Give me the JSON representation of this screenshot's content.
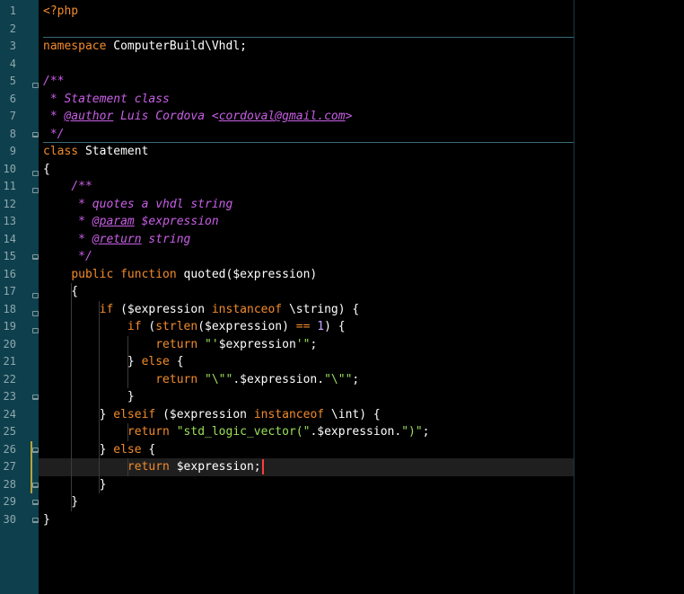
{
  "editor": {
    "language": "php",
    "current_line": 27,
    "colors": {
      "gutter": "#0e3f4c",
      "background": "#000000",
      "keyword": "#f28b2c",
      "comment": "#c95fe7",
      "string": "#9ae15a",
      "number": "#c9a5ff",
      "caret": "#ff3b3b"
    },
    "line_numbers": [
      "1",
      "2",
      "3",
      "4",
      "5",
      "6",
      "7",
      "8",
      "9",
      "10",
      "11",
      "12",
      "13",
      "14",
      "15",
      "16",
      "17",
      "18",
      "19",
      "20",
      "21",
      "22",
      "23",
      "24",
      "25",
      "26",
      "27",
      "28",
      "29",
      "30"
    ],
    "lines": [
      [
        {
          "t": "<?php",
          "c": "kw"
        }
      ],
      [],
      [
        {
          "t": "namespace",
          "c": "kw"
        },
        {
          "t": " ComputerBuild\\Vhdl;",
          "c": "ident"
        }
      ],
      [],
      [
        {
          "t": "/**",
          "c": "cm"
        }
      ],
      [
        {
          "t": " * Statement class",
          "c": "cm"
        }
      ],
      [
        {
          "t": " * ",
          "c": "cm"
        },
        {
          "t": "@author",
          "c": "cm-tag"
        },
        {
          "t": " Luis Cordova <",
          "c": "cm"
        },
        {
          "t": "cordoval@gmail.com",
          "c": "cm-tag"
        },
        {
          "t": ">",
          "c": "cm"
        }
      ],
      [
        {
          "t": " */",
          "c": "cm"
        }
      ],
      [
        {
          "t": "class",
          "c": "kw"
        },
        {
          "t": " Statement",
          "c": "ident"
        }
      ],
      [
        {
          "t": "{",
          "c": "ident"
        }
      ],
      [
        {
          "t": "    ",
          "c": "ident"
        },
        {
          "t": "/**",
          "c": "cm"
        }
      ],
      [
        {
          "t": "     * quotes a vhdl string",
          "c": "cm"
        }
      ],
      [
        {
          "t": "     * ",
          "c": "cm"
        },
        {
          "t": "@param",
          "c": "cm-tag"
        },
        {
          "t": " $expression",
          "c": "cm"
        }
      ],
      [
        {
          "t": "     * ",
          "c": "cm"
        },
        {
          "t": "@return",
          "c": "cm-tag"
        },
        {
          "t": " string",
          "c": "cm"
        }
      ],
      [
        {
          "t": "     */",
          "c": "cm"
        }
      ],
      [
        {
          "t": "    ",
          "c": "ident"
        },
        {
          "t": "public function",
          "c": "kw"
        },
        {
          "t": " quoted($expression)",
          "c": "ident"
        }
      ],
      [
        {
          "t": "    {",
          "c": "ident"
        }
      ],
      [
        {
          "t": "        ",
          "c": "ident"
        },
        {
          "t": "if",
          "c": "kw"
        },
        {
          "t": " ($expression ",
          "c": "ident"
        },
        {
          "t": "instanceof",
          "c": "kw"
        },
        {
          "t": " \\string) {",
          "c": "ident"
        }
      ],
      [
        {
          "t": "            ",
          "c": "ident"
        },
        {
          "t": "if",
          "c": "kw"
        },
        {
          "t": " (",
          "c": "ident"
        },
        {
          "t": "strlen",
          "c": "fn-builtin"
        },
        {
          "t": "($expression) ",
          "c": "ident"
        },
        {
          "t": "==",
          "c": "kw"
        },
        {
          "t": " ",
          "c": "ident"
        },
        {
          "t": "1",
          "c": "num"
        },
        {
          "t": ") {",
          "c": "ident"
        }
      ],
      [
        {
          "t": "                ",
          "c": "ident"
        },
        {
          "t": "return",
          "c": "kw"
        },
        {
          "t": " ",
          "c": "ident"
        },
        {
          "t": "\"'",
          "c": "str"
        },
        {
          "t": "$expression",
          "c": "ident"
        },
        {
          "t": "'\"",
          "c": "str"
        },
        {
          "t": ";",
          "c": "ident"
        }
      ],
      [
        {
          "t": "            } ",
          "c": "ident"
        },
        {
          "t": "else",
          "c": "kw"
        },
        {
          "t": " {",
          "c": "ident"
        }
      ],
      [
        {
          "t": "                ",
          "c": "ident"
        },
        {
          "t": "return",
          "c": "kw"
        },
        {
          "t": " ",
          "c": "ident"
        },
        {
          "t": "\"\\\"\"",
          "c": "str"
        },
        {
          "t": ".$expression.",
          "c": "ident"
        },
        {
          "t": "\"\\\"\"",
          "c": "str"
        },
        {
          "t": ";",
          "c": "ident"
        }
      ],
      [
        {
          "t": "            }",
          "c": "ident"
        }
      ],
      [
        {
          "t": "        } ",
          "c": "ident"
        },
        {
          "t": "elseif",
          "c": "kw"
        },
        {
          "t": " ($expression ",
          "c": "ident"
        },
        {
          "t": "instanceof",
          "c": "kw"
        },
        {
          "t": " \\int) {",
          "c": "ident"
        }
      ],
      [
        {
          "t": "            ",
          "c": "ident"
        },
        {
          "t": "return",
          "c": "kw"
        },
        {
          "t": " ",
          "c": "ident"
        },
        {
          "t": "\"std_logic_vector(\"",
          "c": "str"
        },
        {
          "t": ".$expression.",
          "c": "ident"
        },
        {
          "t": "\")\"",
          "c": "str"
        },
        {
          "t": ";",
          "c": "ident"
        }
      ],
      [
        {
          "t": "        } ",
          "c": "ident"
        },
        {
          "t": "else",
          "c": "kw"
        },
        {
          "t": " {",
          "c": "ident"
        }
      ],
      [
        {
          "t": "            ",
          "c": "ident"
        },
        {
          "t": "return",
          "c": "kw"
        },
        {
          "t": " $expression;",
          "c": "ident"
        }
      ],
      [
        {
          "t": "        }",
          "c": "ident"
        }
      ],
      [
        {
          "t": "    }",
          "c": "ident"
        }
      ],
      [
        {
          "t": "}",
          "c": "ident"
        }
      ]
    ]
  }
}
